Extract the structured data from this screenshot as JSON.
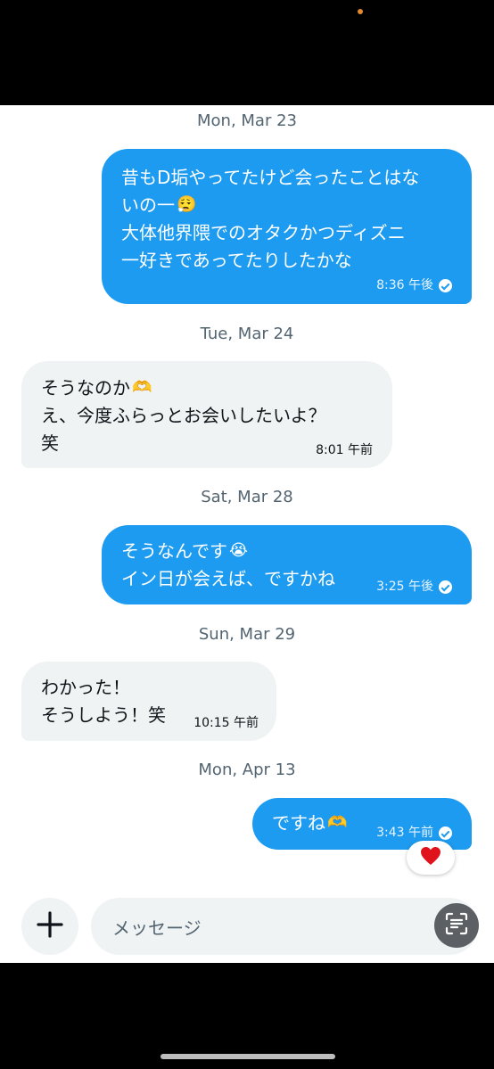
{
  "composer": {
    "placeholder": "メッセージ"
  },
  "dates": {
    "d1": "Mon, Mar 23",
    "d2": "Tue, Mar 24",
    "d3": "Sat, Mar 28",
    "d4": "Sun, Mar 29",
    "d5": "Mon, Apr 13"
  },
  "messages": {
    "m1": {
      "lines": [
        "昔もD垢やってたけど会ったことはな",
        "いの一",
        "大体他界隈でのオタクかつディズニ",
        "一好きであってたりしたかな"
      ],
      "time": "8:36 午後"
    },
    "m2": {
      "lines": [
        "そうなのか",
        "え、今度ふらっとお会いしたいよ？",
        "笑"
      ],
      "time": "8:01 午前"
    },
    "m3": {
      "lines": [
        "そうなんです",
        "イン日が会えば、ですかね"
      ],
      "time": "3:25 午後"
    },
    "m4": {
      "lines": [
        "わかった！",
        "そうしよう！笑"
      ],
      "time": "10:15 午前"
    },
    "m5": {
      "lines": [
        "ですね"
      ],
      "time": "3:43 午前"
    }
  },
  "emoji": {
    "m1": "😮‍💨",
    "m2": "🫶",
    "m3": "😭",
    "m5": "🫶",
    "reaction": "❤️"
  },
  "colors": {
    "sent_bubble": "#1d9bf0",
    "received_bubble": "#eff3f4",
    "reaction_heart": "#e0131c"
  }
}
